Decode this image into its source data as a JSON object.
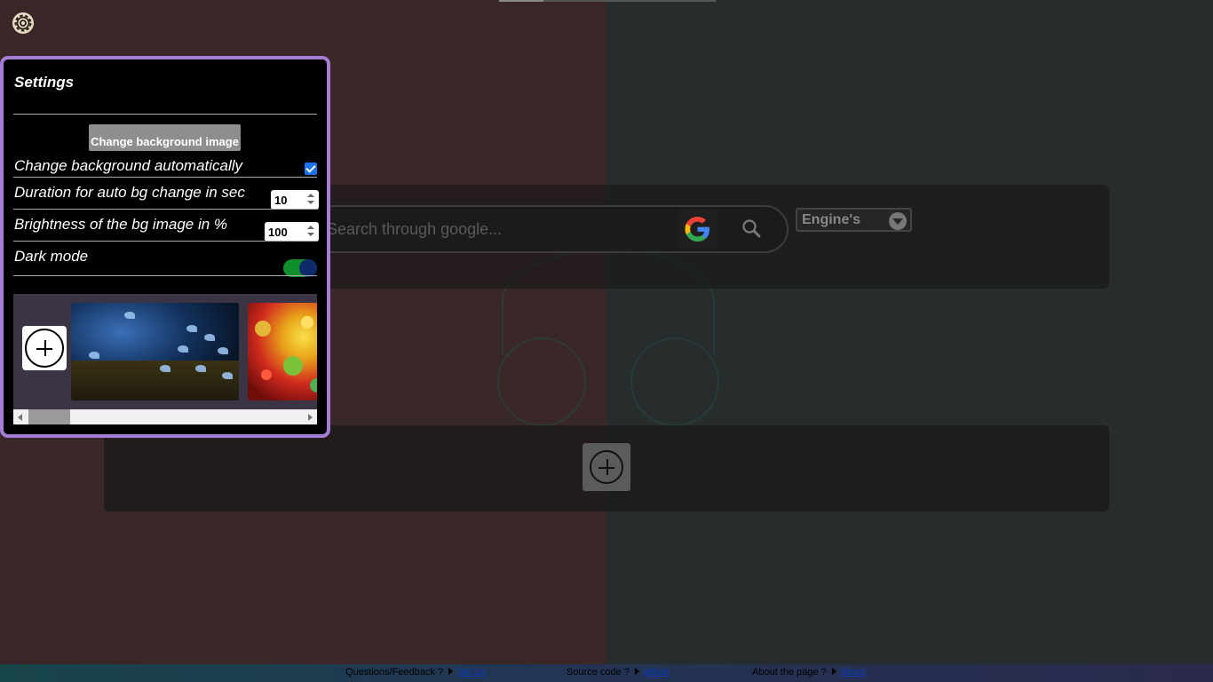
{
  "search": {
    "placeholder": "Search through google...",
    "engine_label": "Engine's"
  },
  "settings": {
    "title": "Settings",
    "change_bg_button": "Change background image",
    "auto_bg_label": "Change background automatically",
    "auto_bg_checked": true,
    "duration_label": "Duration for auto bg change in sec",
    "duration_value": "10",
    "brightness_label": "Brightness of the bg image in %",
    "brightness_value": "100",
    "dark_mode_label": "Dark mode",
    "dark_mode_on": true
  },
  "footer": {
    "feedback_label": "Questions/Feedback ?",
    "feedback_link": "Tell Us",
    "source_label": "Source code ?",
    "source_link": "github",
    "about_label": "About the page ?",
    "about_link": "About"
  },
  "colors": {
    "settings_border": "#a57cd6",
    "toggle_track": "#0f8f2b",
    "toggle_knob": "#0d2a6b",
    "checkbox": "#1a73e8",
    "link": "#0b3bb5"
  },
  "icons": [
    "gear-icon",
    "google-logo-icon",
    "search-icon",
    "chevron-down-icon",
    "plus-icon",
    "scroll-left-icon",
    "scroll-right-icon",
    "triangle-right-icon"
  ]
}
